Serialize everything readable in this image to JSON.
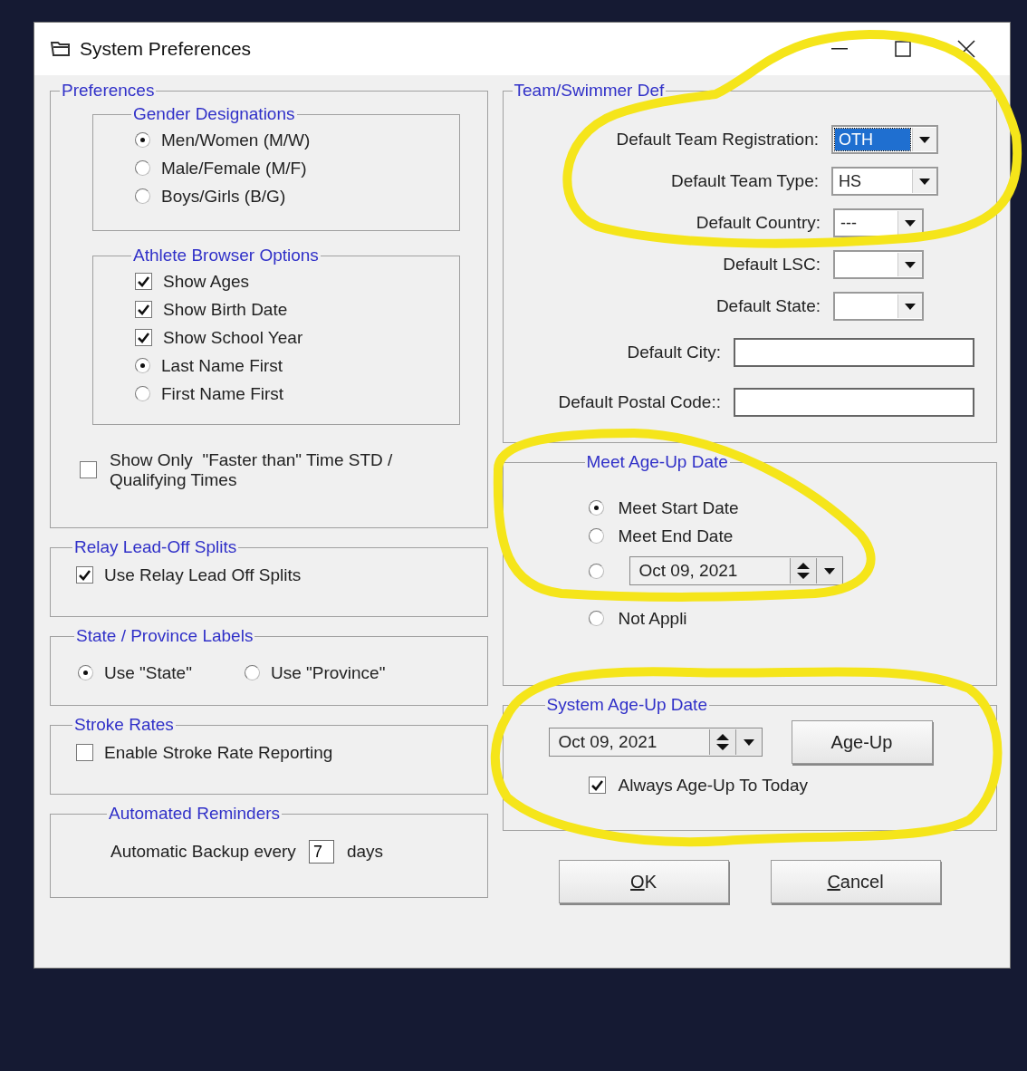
{
  "window": {
    "title": "System Preferences"
  },
  "preferences": {
    "legend": "Preferences",
    "gender": {
      "legend": "Gender Designations",
      "options": [
        {
          "label": "Men/Women (M/W)",
          "selected": true
        },
        {
          "label": "Male/Female (M/F)",
          "selected": false
        },
        {
          "label": "Boys/Girls (B/G)",
          "selected": false
        }
      ]
    },
    "athlete_browser": {
      "legend": "Athlete Browser Options",
      "options": [
        {
          "kind": "checkbox",
          "label": "Show Ages",
          "checked": true
        },
        {
          "kind": "checkbox",
          "label": "Show Birth Date",
          "checked": true
        },
        {
          "kind": "checkbox",
          "label": "Show School Year",
          "checked": true
        },
        {
          "kind": "radio",
          "label": "Last Name First",
          "checked": true
        },
        {
          "kind": "radio",
          "label": "First Name First",
          "checked": false
        }
      ]
    },
    "faster_than": {
      "label": "Show Only  \"Faster than\" Time STD / Qualifying Times",
      "checked": false
    }
  },
  "relay": {
    "legend": "Relay Lead-Off Splits",
    "label": "Use Relay Lead Off Splits",
    "checked": true
  },
  "state_labels": {
    "legend": "State / Province Labels",
    "options": [
      {
        "label": "Use \"State\"",
        "selected": true
      },
      {
        "label": "Use \"Province\"",
        "selected": false
      }
    ]
  },
  "stroke_rates": {
    "legend": "Stroke Rates",
    "label": "Enable Stroke Rate Reporting",
    "checked": false
  },
  "reminders": {
    "legend": "Automated Reminders",
    "prefix": "Automatic Backup every",
    "value": "7",
    "suffix": "days"
  },
  "team_defaults": {
    "legend": "Team/Swimmer Def",
    "fields": [
      {
        "kind": "combo",
        "label": "Default Team Registration:",
        "value": "OTH",
        "selected": true
      },
      {
        "kind": "combo",
        "label": "Default Team Type:",
        "value": "HS",
        "selected": false
      },
      {
        "kind": "combo",
        "label": "Default Country:",
        "value": "---",
        "selected": false
      },
      {
        "kind": "combo",
        "label": "Default LSC:",
        "selected": false
      },
      {
        "kind": "combo",
        "label": "Default State:",
        "selected": false
      },
      {
        "kind": "text",
        "label": "Default City:"
      },
      {
        "kind": "text",
        "label": "Default Postal Code::"
      }
    ]
  },
  "meet_age_up": {
    "legend": "Meet Age-Up Date",
    "options": [
      {
        "kind": "label",
        "label": "Meet Start Date",
        "selected": true
      },
      {
        "kind": "label",
        "label": "Meet End Date",
        "selected": false
      },
      {
        "kind": "date",
        "date": "Oct 09, 2021",
        "selected": false
      },
      {
        "kind": "label",
        "label": "Not Appli",
        "selected": false
      }
    ]
  },
  "system_age_up": {
    "legend": "System Age-Up Date",
    "date": "Oct 09, 2021",
    "button": "Age-Up",
    "always_label": "Always Age-Up To Today",
    "always_checked": true
  },
  "buttons": [
    "OK",
    "Cancel"
  ]
}
